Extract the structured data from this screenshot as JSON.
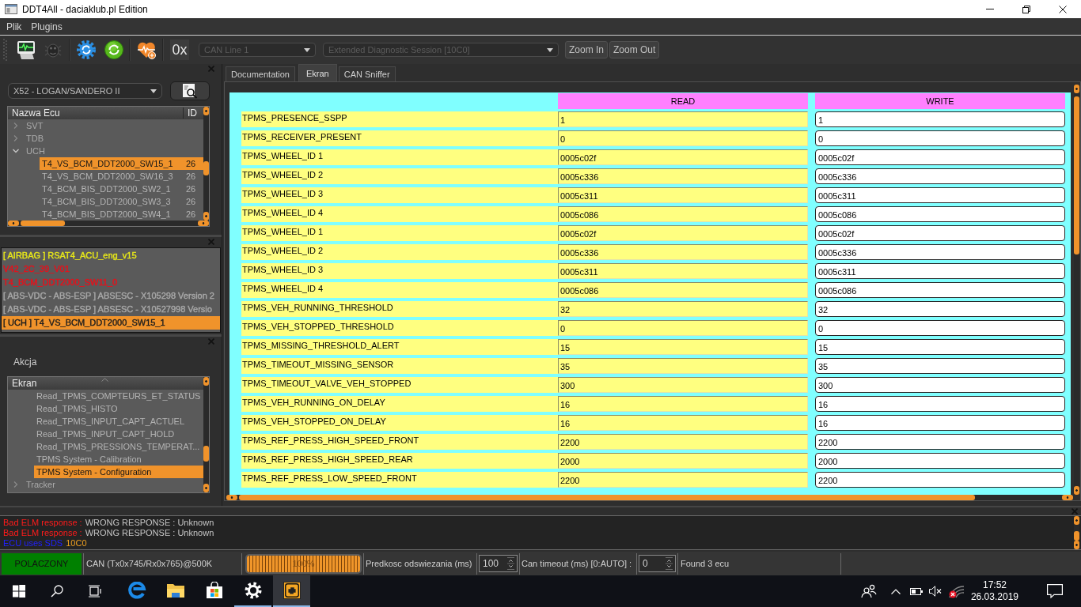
{
  "window": {
    "title": "DDT4All - daciaklub.pl Edition"
  },
  "menu": [
    "Plik",
    "Plugins"
  ],
  "toolbar": {
    "hex_button": "0x",
    "can_line": {
      "value": "CAN Line 1",
      "disabled": true
    },
    "session": {
      "value": "Extended Diagnostic Session [10C0]",
      "disabled": true
    },
    "buttons": [
      "Zoom In",
      "Zoom Out"
    ]
  },
  "vehicle": {
    "value": "X52 - LOGAN/SANDERO II"
  },
  "ecu_tree": {
    "columns": [
      "Nazwa Ecu",
      "ID"
    ],
    "items": [
      {
        "label": "SVT",
        "expanded": false,
        "selected": false
      },
      {
        "label": "TDB",
        "expanded": false,
        "selected": false
      },
      {
        "label": "UCH",
        "expanded": true,
        "selected": false,
        "children": [
          {
            "label": "T4_VS_BCM_DDT2000_SW15_1",
            "id": "26",
            "selected": true
          },
          {
            "label": "T4_VS_BCM_DDT2000_SW16_3",
            "id": "26",
            "selected": false
          },
          {
            "label": "T4_BCM_BIS_DDT2000_SW2_1",
            "id": "26",
            "selected": false
          },
          {
            "label": "T4_BCM_BIS_DDT2000_SW3_3",
            "id": "26",
            "selected": false
          },
          {
            "label": "T4_BCM_BIS_DDT2000_SW4_1",
            "id": "26",
            "selected": false
          }
        ]
      }
    ]
  },
  "found_ecus": [
    {
      "label": "[ AIRBAG ] RSAT4_ACU_eng_v15",
      "color": "#e6e619",
      "selected": false
    },
    {
      "label": "V42_2C_39_V01",
      "color": "#e8101a",
      "selected": false
    },
    {
      "label": "T4_BCM_DDT2000_SW11_0",
      "color": "#e8101a",
      "selected": false
    },
    {
      "label": "[ ABS-VDC - ABS-ESP ] ABSESC - X105298 Version 2",
      "color": "#a8a8a8",
      "selected": false
    },
    {
      "label": "[ ABS-VDC - ABS-ESP ] ABSESC - X10527998 Versio",
      "color": "#a8a8a8",
      "selected": false
    },
    {
      "label": "[ UCH ] T4_VS_BCM_DDT2000_SW15_1",
      "color": "#1e1e1e",
      "selected": true
    }
  ],
  "actions": {
    "label": "Akcja",
    "header": "Ekran",
    "entries": [
      {
        "label": "Read_TPMS_COMPTEURS_ET_STATUS",
        "selected": false
      },
      {
        "label": "Read_TPMS_HISTO",
        "selected": false
      },
      {
        "label": "Read_TPMS_INPUT_CAPT_ACTUEL",
        "selected": false
      },
      {
        "label": "Read_TPMS_INPUT_CAPT_HOLD",
        "selected": false
      },
      {
        "label": "Read_TPMS_PRESSIONS_TEMPERAT...",
        "selected": false
      },
      {
        "label": "TPMS System - Calibration",
        "selected": false
      },
      {
        "label": "TPMS System - Configuration",
        "selected": true
      }
    ],
    "groups": [
      {
        "label": "Tracker",
        "expanded": false
      }
    ]
  },
  "screen": {
    "tabs": [
      {
        "label": "Documentation",
        "selected": false
      },
      {
        "label": "Ekran",
        "selected": true
      },
      {
        "label": "CAN Sniffer",
        "selected": false
      }
    ],
    "columns": [
      "READ",
      "WRITE"
    ],
    "rows": [
      {
        "name": "TPMS_PRESENCE_SSPP",
        "read": "1",
        "write": "1"
      },
      {
        "name": "TPMS_RECEIVER_PRESENT",
        "read": "0",
        "write": "0"
      },
      {
        "name": "TPMS_WHEEL_ID 1",
        "read": "0005c02f",
        "write": "0005c02f"
      },
      {
        "name": "TPMS_WHEEL_ID 2",
        "read": "0005c336",
        "write": "0005c336"
      },
      {
        "name": "TPMS_WHEEL_ID 3",
        "read": "0005c311",
        "write": "0005c311"
      },
      {
        "name": "TPMS_WHEEL_ID 4",
        "read": "0005c086",
        "write": "0005c086"
      },
      {
        "name": "TPMS_WHEEL_ID 1",
        "read": "0005c02f",
        "write": "0005c02f"
      },
      {
        "name": "TPMS_WHEEL_ID 2",
        "read": "0005c336",
        "write": "0005c336"
      },
      {
        "name": "TPMS_WHEEL_ID 3",
        "read": "0005c311",
        "write": "0005c311"
      },
      {
        "name": "TPMS_WHEEL_ID 4",
        "read": "0005c086",
        "write": "0005c086"
      },
      {
        "name": "TPMS_VEH_RUNNING_THRESHOLD",
        "read": "32",
        "write": "32"
      },
      {
        "name": "TPMS_VEH_STOPPED_THRESHOLD",
        "read": "0",
        "write": "0"
      },
      {
        "name": "TPMS_MISSING_THRESHOLD_ALERT",
        "read": "15",
        "write": "15"
      },
      {
        "name": "TPMS_TIMEOUT_MISSING_SENSOR",
        "read": "35",
        "write": "35"
      },
      {
        "name": "TPMS_TIMEOUT_VALVE_VEH_STOPPED",
        "read": "300",
        "write": "300"
      },
      {
        "name": "TPMS_VEH_RUNNING_ON_DELAY",
        "read": "16",
        "write": "16"
      },
      {
        "name": "TPMS_VEH_STOPPED_ON_DELAY",
        "read": "16",
        "write": "16"
      },
      {
        "name": "TPMS_REF_PRESS_HIGH_SPEED_FRONT",
        "read": "2200",
        "write": "2200"
      },
      {
        "name": "TPMS_REF_PRESS_HIGH_SPEED_REAR",
        "read": "2000",
        "write": "2000"
      },
      {
        "name": "TPMS_REF_PRESS_LOW_SPEED_FRONT",
        "read": "2200",
        "write": "2200"
      }
    ]
  },
  "log": [
    {
      "parts": [
        {
          "kind": "error",
          "text": "Bad ELM response :"
        },
        {
          "kind": "text",
          "text": "WRONG RESPONSE : Unknown"
        }
      ]
    },
    {
      "parts": [
        {
          "kind": "error",
          "text": "Bad ELM response :"
        },
        {
          "kind": "text",
          "text": "WRONG RESPONSE : Unknown"
        }
      ]
    },
    {
      "parts": [
        {
          "kind": "info",
          "text": "ECU uses SDS"
        },
        {
          "kind": "value",
          "text": "10C0"
        }
      ]
    }
  ],
  "status_bar": {
    "connection": {
      "label": "POLACZONY",
      "connected": true
    },
    "can_info": "CAN (Tx0x745/Rx0x765)@500K",
    "progress": {
      "label": "100%",
      "level": 1
    },
    "refresh": {
      "label": "Predkosc odswiezania (ms)",
      "value": "100"
    },
    "timeout": {
      "label": "Can timeout (ms) [0:AUTO] :",
      "value": "0"
    },
    "found": "Found 3 ecu"
  },
  "taskbar": {
    "apps": [
      {
        "kind": "browser",
        "running": false,
        "selected": false
      },
      {
        "kind": "folder",
        "running": false,
        "selected": false
      },
      {
        "kind": "store",
        "running": false,
        "selected": false
      },
      {
        "kind": "settings",
        "running": true,
        "selected": false
      },
      {
        "kind": "diagnostic",
        "running": true,
        "selected": true
      }
    ],
    "time": "17:52",
    "date": "26.03.2019"
  }
}
